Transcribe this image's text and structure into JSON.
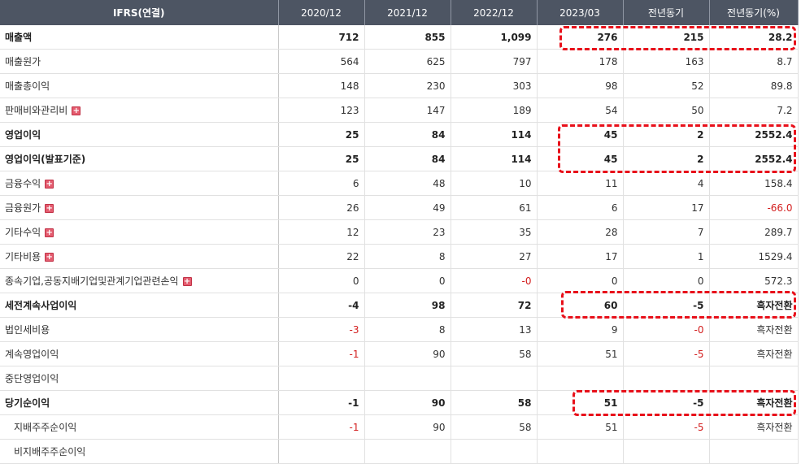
{
  "headers": [
    "IFRS(연결)",
    "2020/12",
    "2021/12",
    "2022/12",
    "2023/03",
    "전년동기",
    "전년동기(%)"
  ],
  "rows": [
    {
      "label": "매출액",
      "bold": true,
      "plus": false,
      "indent": false,
      "values": [
        "712",
        "855",
        "1,099",
        "276",
        "215",
        "28.2"
      ],
      "neg": [
        false,
        false,
        false,
        false,
        false,
        false
      ]
    },
    {
      "label": "매출원가",
      "bold": false,
      "plus": false,
      "indent": false,
      "values": [
        "564",
        "625",
        "797",
        "178",
        "163",
        "8.7"
      ],
      "neg": [
        false,
        false,
        false,
        false,
        false,
        false
      ]
    },
    {
      "label": "매출총이익",
      "bold": false,
      "plus": false,
      "indent": false,
      "values": [
        "148",
        "230",
        "303",
        "98",
        "52",
        "89.8"
      ],
      "neg": [
        false,
        false,
        false,
        false,
        false,
        false
      ]
    },
    {
      "label": "판매비와관리비",
      "bold": false,
      "plus": true,
      "indent": false,
      "values": [
        "123",
        "147",
        "189",
        "54",
        "50",
        "7.2"
      ],
      "neg": [
        false,
        false,
        false,
        false,
        false,
        false
      ]
    },
    {
      "label": "영업이익",
      "bold": true,
      "plus": false,
      "indent": false,
      "values": [
        "25",
        "84",
        "114",
        "45",
        "2",
        "2552.4"
      ],
      "neg": [
        false,
        false,
        false,
        false,
        false,
        false
      ]
    },
    {
      "label": "영업이익(발표기준)",
      "bold": true,
      "plus": false,
      "indent": false,
      "values": [
        "25",
        "84",
        "114",
        "45",
        "2",
        "2552.4"
      ],
      "neg": [
        false,
        false,
        false,
        false,
        false,
        false
      ]
    },
    {
      "label": "금융수익",
      "bold": false,
      "plus": true,
      "indent": false,
      "values": [
        "6",
        "48",
        "10",
        "11",
        "4",
        "158.4"
      ],
      "neg": [
        false,
        false,
        false,
        false,
        false,
        false
      ]
    },
    {
      "label": "금융원가",
      "bold": false,
      "plus": true,
      "indent": false,
      "values": [
        "26",
        "49",
        "61",
        "6",
        "17",
        "-66.0"
      ],
      "neg": [
        false,
        false,
        false,
        false,
        false,
        true
      ]
    },
    {
      "label": "기타수익",
      "bold": false,
      "plus": true,
      "indent": false,
      "values": [
        "12",
        "23",
        "35",
        "28",
        "7",
        "289.7"
      ],
      "neg": [
        false,
        false,
        false,
        false,
        false,
        false
      ]
    },
    {
      "label": "기타비용",
      "bold": false,
      "plus": true,
      "indent": false,
      "values": [
        "22",
        "8",
        "27",
        "17",
        "1",
        "1529.4"
      ],
      "neg": [
        false,
        false,
        false,
        false,
        false,
        false
      ]
    },
    {
      "label": "종속기업,공동지배기업및관계기업관련손익",
      "bold": false,
      "plus": true,
      "indent": false,
      "values": [
        "0",
        "0",
        "-0",
        "0",
        "0",
        "572.3"
      ],
      "neg": [
        false,
        false,
        true,
        false,
        false,
        false
      ]
    },
    {
      "label": "세전계속사업이익",
      "bold": true,
      "plus": false,
      "indent": false,
      "values": [
        "-4",
        "98",
        "72",
        "60",
        "-5",
        "흑자전환"
      ],
      "neg": [
        true,
        false,
        false,
        false,
        true,
        false
      ]
    },
    {
      "label": "법인세비용",
      "bold": false,
      "plus": false,
      "indent": false,
      "values": [
        "-3",
        "8",
        "13",
        "9",
        "-0",
        "흑자전환"
      ],
      "neg": [
        true,
        false,
        false,
        false,
        true,
        false
      ]
    },
    {
      "label": "계속영업이익",
      "bold": false,
      "plus": false,
      "indent": false,
      "values": [
        "-1",
        "90",
        "58",
        "51",
        "-5",
        "흑자전환"
      ],
      "neg": [
        true,
        false,
        false,
        false,
        true,
        false
      ]
    },
    {
      "label": "중단영업이익",
      "bold": false,
      "plus": false,
      "indent": false,
      "values": [
        "",
        "",
        "",
        "",
        "",
        ""
      ],
      "neg": [
        false,
        false,
        false,
        false,
        false,
        false
      ]
    },
    {
      "label": "당기순이익",
      "bold": true,
      "plus": false,
      "indent": false,
      "values": [
        "-1",
        "90",
        "58",
        "51",
        "-5",
        "흑자전환"
      ],
      "neg": [
        true,
        false,
        false,
        false,
        true,
        false
      ]
    },
    {
      "label": "지배주주순이익",
      "bold": false,
      "plus": false,
      "indent": true,
      "values": [
        "-1",
        "90",
        "58",
        "51",
        "-5",
        "흑자전환"
      ],
      "neg": [
        true,
        false,
        false,
        false,
        true,
        false
      ]
    },
    {
      "label": "비지배주주순이익",
      "bold": false,
      "plus": false,
      "indent": true,
      "values": [
        "",
        "",
        "",
        "",
        "",
        ""
      ],
      "neg": [
        false,
        false,
        false,
        false,
        false,
        false
      ]
    }
  ],
  "colors": {
    "header_bg": "#4d5563",
    "negative": "#d31e1e",
    "highlight": "#e8101a"
  },
  "icons": {
    "expand": "plus-box-icon"
  }
}
